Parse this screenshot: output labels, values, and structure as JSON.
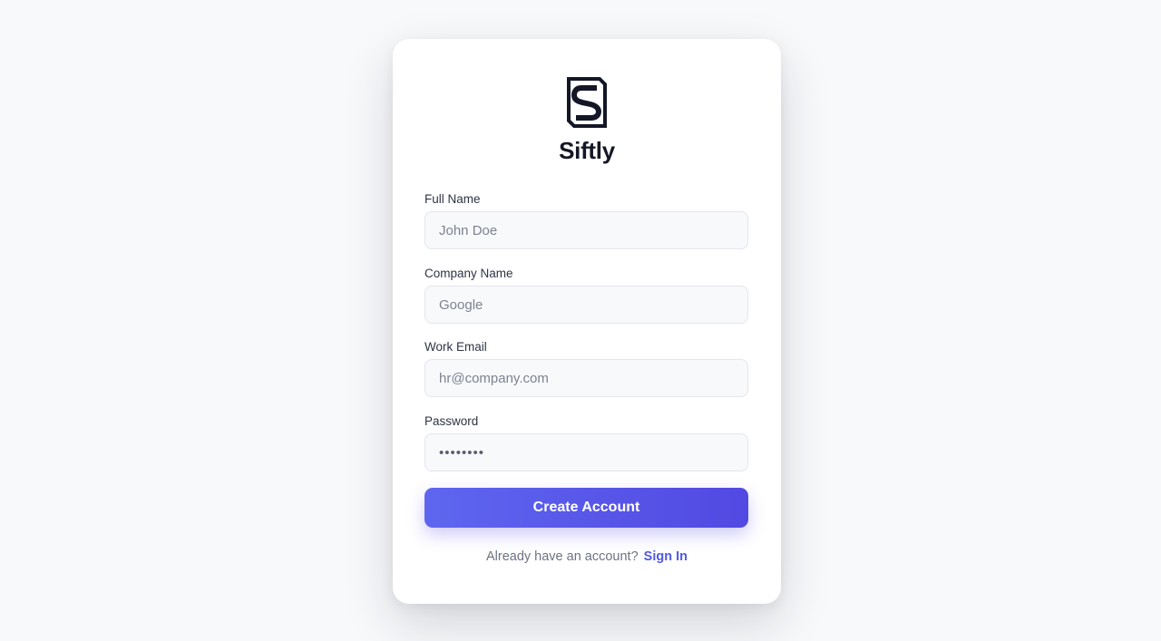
{
  "brand": {
    "name": "Siftly",
    "logo_icon": "s-monogram-logo"
  },
  "form": {
    "fields": [
      {
        "label": "Full Name",
        "placeholder": "John Doe",
        "value": ""
      },
      {
        "label": "Company Name",
        "placeholder": "Google",
        "value": ""
      },
      {
        "label": "Work Email",
        "placeholder": "hr@company.com",
        "value": ""
      },
      {
        "label": "Password",
        "placeholder": "",
        "value": "••••••••"
      }
    ],
    "submit_label": "Create Account"
  },
  "footer": {
    "prompt": "Already have an account?",
    "link_label": "Sign In"
  },
  "colors": {
    "accent": "#5249e2",
    "accent_light": "#5e66ef",
    "background": "#f8f9fb",
    "text_dark": "#141726"
  }
}
